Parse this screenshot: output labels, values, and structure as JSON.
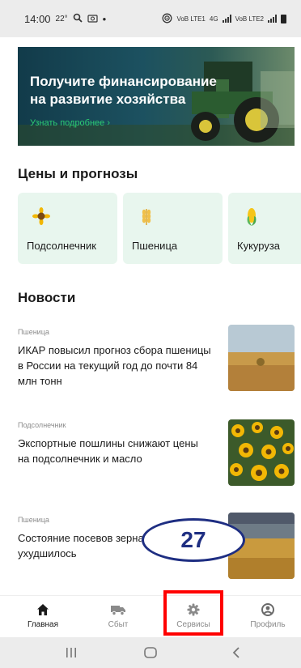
{
  "status_bar": {
    "time": "14:00",
    "temperature": "22°",
    "dot": "•",
    "network_1": "VoB LTE1",
    "network_2": "4G",
    "network_3": "VoB LTE2"
  },
  "banner": {
    "title": "Получите финансирование на развитие хозяйства",
    "link": "Узнать подробнее ›"
  },
  "prices": {
    "title": "Цены и прогнозы",
    "items": [
      {
        "label": "Подсолнечник",
        "icon": "sunflower-icon"
      },
      {
        "label": "Пшеница",
        "icon": "wheat-icon"
      },
      {
        "label": "Кукуруза",
        "icon": "corn-icon"
      }
    ]
  },
  "news": {
    "title": "Новости",
    "items": [
      {
        "category": "Пшеница",
        "headline": "ИКАР повысил прогноз сбора пшеницы в России на текущий год до почти 84 млн тонн"
      },
      {
        "category": "Подсолнечник",
        "headline": "Экспортные пошлины снижают цены на подсолнечник и масло"
      },
      {
        "category": "Пшеница",
        "headline": "Состояние посевов зерна во Франции ухудшилось"
      }
    ]
  },
  "callout": {
    "number": "27"
  },
  "bottom_nav": {
    "items": [
      {
        "label": "Главная",
        "icon": "home-icon"
      },
      {
        "label": "Сбыт",
        "icon": "truck-icon"
      },
      {
        "label": "Сервисы",
        "icon": "gear-icon"
      },
      {
        "label": "Профиль",
        "icon": "profile-icon"
      }
    ],
    "active": "Главная",
    "highlighted": "Сервисы"
  },
  "colors": {
    "accent_green": "#2ecc71",
    "card_background": "#e8f6ee",
    "highlight_red": "#ff0000",
    "callout_blue": "#1e2e82"
  }
}
